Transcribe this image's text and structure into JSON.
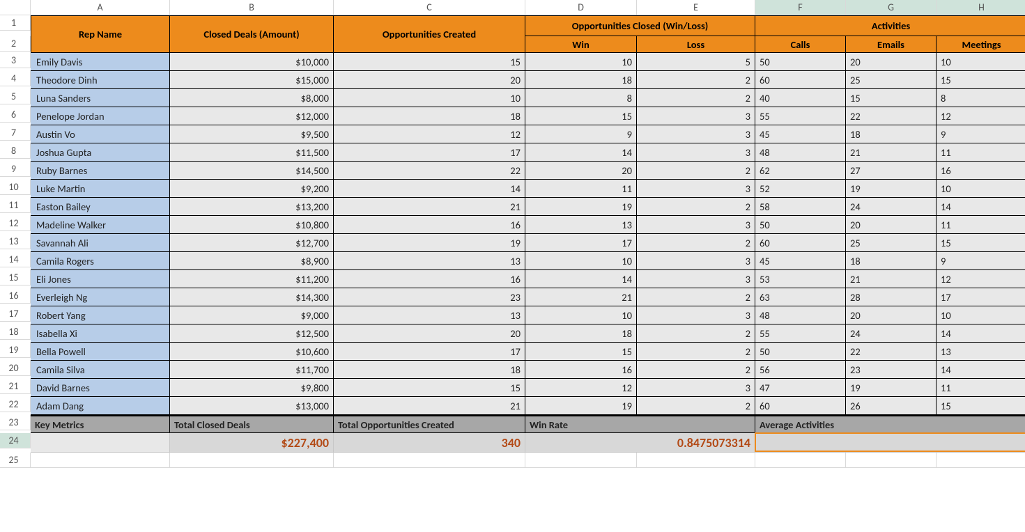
{
  "columns": [
    "A",
    "B",
    "C",
    "D",
    "E",
    "F",
    "G",
    "H"
  ],
  "header": {
    "rep_name": "Rep Name",
    "closed_deals": "Closed Deals (Amount)",
    "opp_created": "Opportunities Created",
    "opp_closed": "Opportunities Closed (Win/Loss)",
    "win": "Win",
    "loss": "Loss",
    "activities": "Activities",
    "calls": "Calls",
    "emails": "Emails",
    "meetings": "Meetings"
  },
  "rows": [
    {
      "name": "Emily Davis",
      "amount": "$10,000",
      "opp": "15",
      "win": "10",
      "loss": "5",
      "calls": "50",
      "emails": "20",
      "meetings": "10"
    },
    {
      "name": "Theodore Dinh",
      "amount": "$15,000",
      "opp": "20",
      "win": "18",
      "loss": "2",
      "calls": "60",
      "emails": "25",
      "meetings": "15"
    },
    {
      "name": "Luna Sanders",
      "amount": "$8,000",
      "opp": "10",
      "win": "8",
      "loss": "2",
      "calls": "40",
      "emails": "15",
      "meetings": "8"
    },
    {
      "name": "Penelope Jordan",
      "amount": "$12,000",
      "opp": "18",
      "win": "15",
      "loss": "3",
      "calls": "55",
      "emails": "22",
      "meetings": "12"
    },
    {
      "name": "Austin Vo",
      "amount": "$9,500",
      "opp": "12",
      "win": "9",
      "loss": "3",
      "calls": "45",
      "emails": "18",
      "meetings": "9"
    },
    {
      "name": "Joshua Gupta",
      "amount": "$11,500",
      "opp": "17",
      "win": "14",
      "loss": "3",
      "calls": "48",
      "emails": "21",
      "meetings": "11"
    },
    {
      "name": "Ruby Barnes",
      "amount": "$14,500",
      "opp": "22",
      "win": "20",
      "loss": "2",
      "calls": "62",
      "emails": "27",
      "meetings": "16"
    },
    {
      "name": "Luke Martin",
      "amount": "$9,200",
      "opp": "14",
      "win": "11",
      "loss": "3",
      "calls": "52",
      "emails": "19",
      "meetings": "10"
    },
    {
      "name": "Easton Bailey",
      "amount": "$13,200",
      "opp": "21",
      "win": "19",
      "loss": "2",
      "calls": "58",
      "emails": "24",
      "meetings": "14"
    },
    {
      "name": "Madeline Walker",
      "amount": "$10,800",
      "opp": "16",
      "win": "13",
      "loss": "3",
      "calls": "50",
      "emails": "20",
      "meetings": "11"
    },
    {
      "name": "Savannah Ali",
      "amount": "$12,700",
      "opp": "19",
      "win": "17",
      "loss": "2",
      "calls": "60",
      "emails": "25",
      "meetings": "15"
    },
    {
      "name": "Camila Rogers",
      "amount": "$8,900",
      "opp": "13",
      "win": "10",
      "loss": "3",
      "calls": "45",
      "emails": "18",
      "meetings": "9"
    },
    {
      "name": "Eli Jones",
      "amount": "$11,200",
      "opp": "16",
      "win": "14",
      "loss": "3",
      "calls": "53",
      "emails": "21",
      "meetings": "12"
    },
    {
      "name": "Everleigh Ng",
      "amount": "$14,300",
      "opp": "23",
      "win": "21",
      "loss": "2",
      "calls": "63",
      "emails": "28",
      "meetings": "17"
    },
    {
      "name": "Robert Yang",
      "amount": "$9,000",
      "opp": "13",
      "win": "10",
      "loss": "3",
      "calls": "48",
      "emails": "20",
      "meetings": "10"
    },
    {
      "name": "Isabella Xi",
      "amount": "$12,500",
      "opp": "20",
      "win": "18",
      "loss": "2",
      "calls": "55",
      "emails": "24",
      "meetings": "14"
    },
    {
      "name": "Bella Powell",
      "amount": "$10,600",
      "opp": "17",
      "win": "15",
      "loss": "2",
      "calls": "50",
      "emails": "22",
      "meetings": "13"
    },
    {
      "name": "Camila Silva",
      "amount": "$11,700",
      "opp": "18",
      "win": "16",
      "loss": "2",
      "calls": "56",
      "emails": "23",
      "meetings": "14"
    },
    {
      "name": "David Barnes",
      "amount": "$9,800",
      "opp": "15",
      "win": "12",
      "loss": "3",
      "calls": "47",
      "emails": "19",
      "meetings": "11"
    },
    {
      "name": "Adam Dang",
      "amount": "$13,000",
      "opp": "21",
      "win": "19",
      "loss": "2",
      "calls": "60",
      "emails": "26",
      "meetings": "15"
    }
  ],
  "key_metrics": {
    "label": "Key Metrics",
    "total_closed_label": "Total Closed Deals",
    "total_opp_label": "Total Opportunities Created",
    "win_rate_label": "Win Rate",
    "avg_act_label": "Average Activities",
    "total_closed": "$227,400",
    "total_opp": "340",
    "win_rate": "0.8475073314"
  }
}
